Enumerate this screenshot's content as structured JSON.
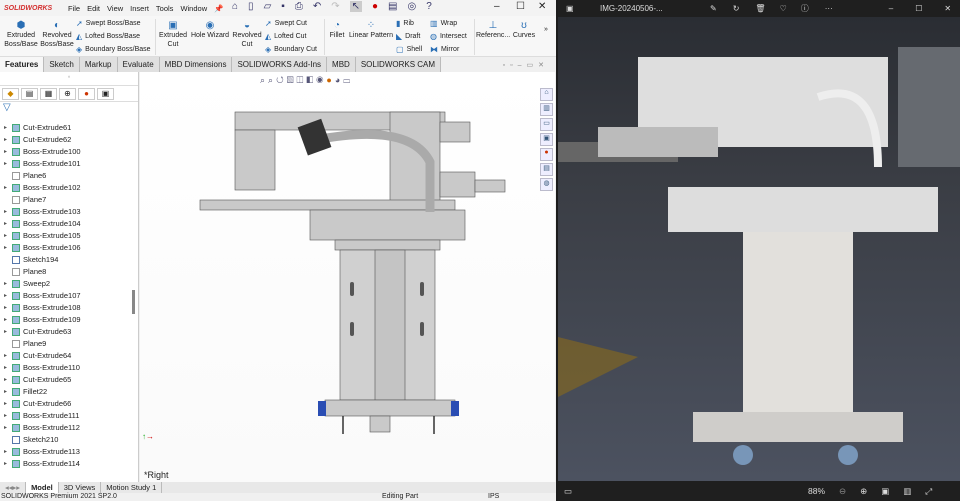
{
  "solidworks": {
    "logo": "SOLIDWORKS",
    "menu": [
      "File",
      "Edit",
      "View",
      "Insert",
      "Tools",
      "Window"
    ],
    "command": {
      "extruded_boss": "Extruded Boss/Base",
      "revolved_boss": "Revolved Boss/Base",
      "swept_boss": "Swept Boss/Base",
      "lofted_boss": "Lofted Boss/Base",
      "boundary_boss": "Boundary Boss/Base",
      "extruded_cut": "Extruded Cut",
      "hole_wizard": "Hole Wizard",
      "revolved_cut": "Revolved Cut",
      "swept_cut": "Swept Cut",
      "lofted_cut": "Lofted Cut",
      "boundary_cut": "Boundary Cut",
      "fillet": "Fillet",
      "linear_pattern": "Linear Pattern",
      "rib": "Rib",
      "draft": "Draft",
      "shell": "Shell",
      "wrap": "Wrap",
      "intersect": "Intersect",
      "mirror": "Mirror",
      "reference": "Referenc...",
      "curves": "Curves"
    },
    "tabs": [
      "Features",
      "Sketch",
      "Markup",
      "Evaluate",
      "MBD Dimensions",
      "SOLIDWORKS Add-Ins",
      "MBD",
      "SOLIDWORKS CAM"
    ],
    "active_tab": "Features",
    "tree": [
      "Cut-Extrude61",
      "Cut-Extrude62",
      "Boss-Extrude100",
      "Boss-Extrude101",
      "Plane6",
      "Boss-Extrude102",
      "Plane7",
      "Boss-Extrude103",
      "Boss-Extrude104",
      "Boss-Extrude105",
      "Boss-Extrude106",
      "Sketch194",
      "Plane8",
      "Sweep2",
      "Boss-Extrude107",
      "Boss-Extrude108",
      "Boss-Extrude109",
      "Cut-Extrude63",
      "Plane9",
      "Cut-Extrude64",
      "Boss-Extrude110",
      "Cut-Extrude65",
      "Fillet22",
      "Cut-Extrude66",
      "Boss-Extrude111",
      "Boss-Extrude112",
      "Sketch210",
      "Boss-Extrude113",
      "Boss-Extrude114"
    ],
    "view_label": "*Right",
    "bottom_tabs": [
      "Model",
      "3D Views",
      "Motion Study 1"
    ],
    "status": {
      "product": "SOLIDWORKS Premium 2021 SP2.0",
      "mode": "Editing Part",
      "units": "IPS"
    }
  },
  "photo_viewer": {
    "title": "IMG-20240506-...",
    "zoom": "88%"
  }
}
